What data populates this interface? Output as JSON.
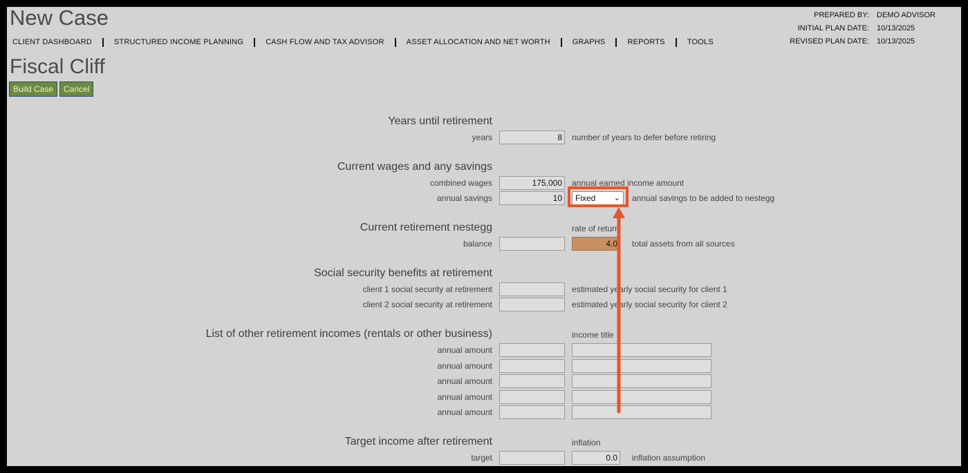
{
  "header": {
    "case_title": "New Case",
    "page_title": "Fiscal Cliff",
    "nav": [
      "CLIENT DASHBOARD",
      "STRUCTURED INCOME PLANNING",
      "CASH FLOW AND TAX ADVISOR",
      "ASSET ALLOCATION AND NET WORTH",
      "GRAPHS",
      "REPORTS",
      "TOOLS"
    ],
    "meta": [
      {
        "label": "PREPARED BY:",
        "value": "DEMO ADVISOR"
      },
      {
        "label": "INITIAL PLAN DATE:",
        "value": "10/13/2025"
      },
      {
        "label": "REVISED PLAN DATE:",
        "value": "10/13/2025"
      }
    ]
  },
  "buttons": {
    "build": "Build Case",
    "cancel": "Cancel"
  },
  "years": {
    "title": "Years until retirement",
    "label": "years",
    "value": "8",
    "desc": "number of years to defer before retiring"
  },
  "wages": {
    "title": "Current wages and any savings",
    "combined_label": "combined wages",
    "combined_value": "175,000",
    "combined_desc": "annual earned income amount",
    "savings_label": "annual savings",
    "savings_value": "10",
    "savings_mode": "Fixed",
    "savings_desc": "annual savings to be added to nestegg"
  },
  "nestegg": {
    "title": "Current retirement nestegg",
    "rate_label": "rate of return",
    "balance_label": "balance",
    "balance_value": "",
    "rate_value": "4.0",
    "desc": "total assets from all sources"
  },
  "social_security": {
    "title": "Social security benefits at retirement",
    "client1_label": "client 1 social security at retirement",
    "client1_desc": "estimated yearly social security for client 1",
    "client2_label": "client 2 social security at retirement",
    "client2_desc": "estimated yearly social security for client 2"
  },
  "other_incomes": {
    "title": "List of other retirement incomes (rentals or other business)",
    "title_col": "income title",
    "row_label": "annual amount"
  },
  "target": {
    "title": "Target income after retirement",
    "inflation_label": "inflation",
    "label": "target",
    "inflation_value": "0.0",
    "desc": "inflation assumption"
  },
  "colors": {
    "background": "#d3d3d3",
    "button": "#6d8a3e",
    "callout": "#e4572e",
    "rate_field": "#c9905f"
  },
  "icons": {
    "dropdown": "chevron-down-icon",
    "annotation": "arrow-up-icon"
  }
}
